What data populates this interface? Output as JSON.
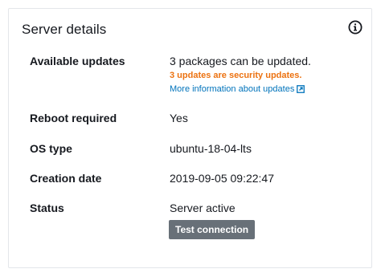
{
  "card": {
    "title": "Server details",
    "info_icon": "info-circle-icon"
  },
  "rows": {
    "available_updates": {
      "label": "Available updates",
      "value": "3 packages can be updated.",
      "security_note": "3 updates are security updates.",
      "link_text": "More information about updates",
      "link_icon": "external-link-icon"
    },
    "reboot_required": {
      "label": "Reboot required",
      "value": "Yes"
    },
    "os_type": {
      "label": "OS type",
      "value": "ubuntu-18-04-lts"
    },
    "creation_date": {
      "label": "Creation date",
      "value": "2019-09-05 09:22:47"
    },
    "status": {
      "label": "Status",
      "value": "Server active",
      "button_label": "Test connection"
    }
  },
  "colors": {
    "warning": "#ec7211",
    "link": "#0073bb",
    "button_bg": "#687078"
  }
}
